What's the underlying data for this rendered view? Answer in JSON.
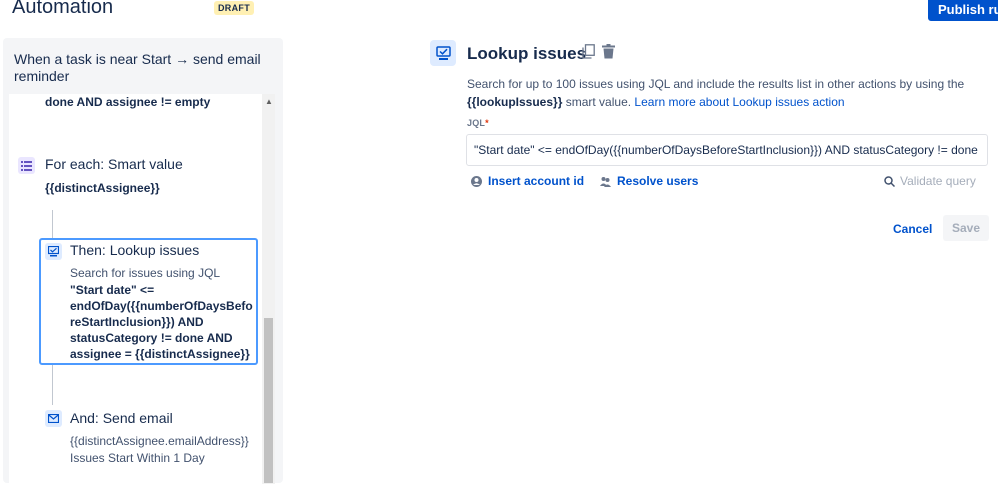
{
  "header": {
    "title": "Automation",
    "draft_badge": "DRAFT",
    "publish_label": "Publish rule"
  },
  "rule": {
    "name": "When a task is near Start → send email reminder"
  },
  "flow": {
    "condition_tail": "done AND assignee != empty",
    "branch": {
      "title": "For each: Smart value",
      "value": "{{distinctAssignee}}",
      "icon": "list-icon"
    },
    "lookup": {
      "title": "Then: Lookup issues",
      "subtitle": "Search for issues using JQL",
      "jql_lines": [
        "\"Start date\" <=",
        "endOfDay({{numberOfDaysBefo",
        "reStartInclusion}}) AND",
        "statusCategory != done AND",
        "assignee = {{distinctAssignee}}"
      ],
      "icon": "lookup-icon"
    },
    "email": {
      "title": "And: Send email",
      "to": "{{distinctAssignee.emailAddress}}",
      "subject": "Issues Start Within 1 Day",
      "icon": "mail-icon"
    }
  },
  "action": {
    "title": "Lookup issues",
    "description_prefix": "Search for up to 100 issues using JQL and include the results list in other actions by using the",
    "smart_value": "{{lookupIssues}}",
    "description_mid": "smart value.",
    "learn_more": "Learn more about Lookup issues action",
    "jql_label": "JQL",
    "jql_required": "*",
    "jql_value": "\"Start date\" <= endOfDay({{numberOfDaysBeforeStartInclusion}}) AND statusCategory != done AND assignee = {{distinctAssignee}}",
    "insert_account_id": "Insert account id",
    "resolve_users": "Resolve users",
    "validate_query": "Validate query",
    "cancel": "Cancel",
    "save": "Save"
  },
  "colors": {
    "primary": "#0052cc",
    "selected_border": "#4c9aff",
    "draft_bg": "#fff0b3"
  }
}
